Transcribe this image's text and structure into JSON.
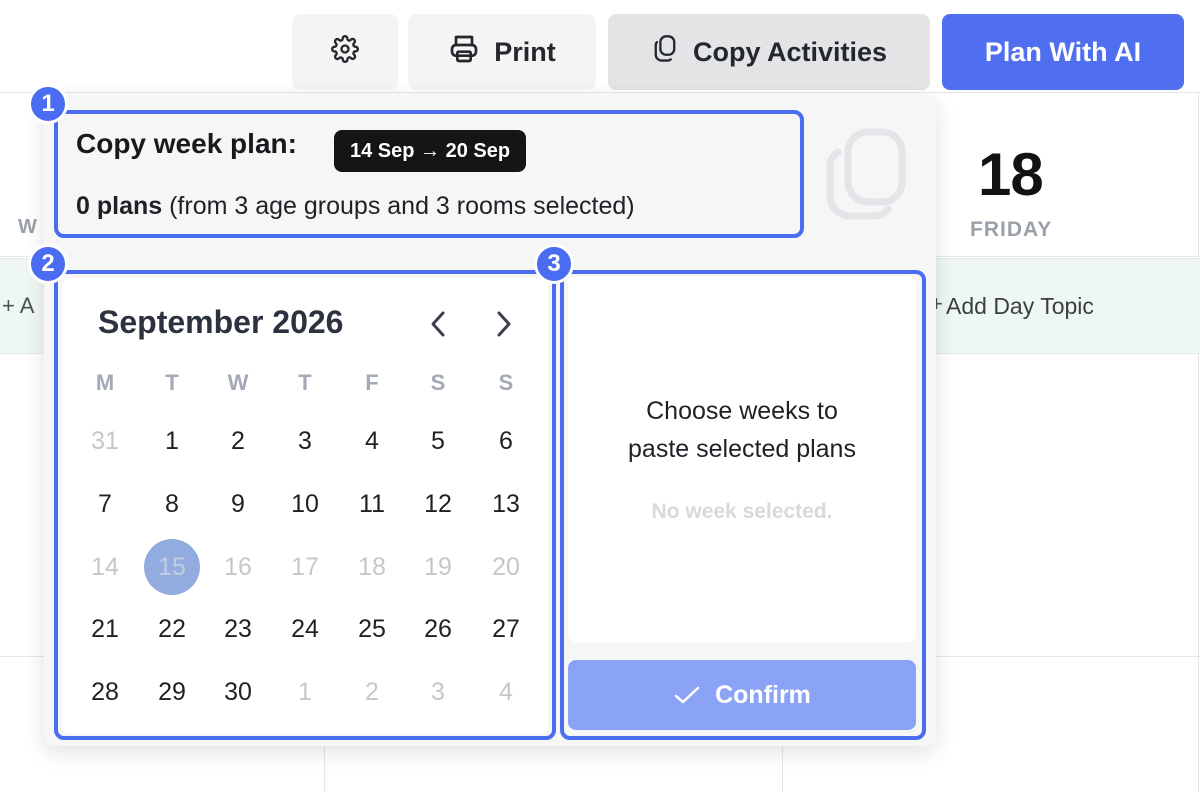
{
  "toolbar": {
    "settings_icon": "gear-icon",
    "print_label": "Print",
    "print_icon": "printer-icon",
    "copy_label": "Copy Activities",
    "copy_icon": "copy-icon",
    "ai_label": "Plan With AI"
  },
  "background": {
    "weekday_partial": "W",
    "add_topic_partial": "+ A",
    "add_topic_label": "Add Day Topic",
    "day_number": "18",
    "day_name": "FRIDAY"
  },
  "copy_panel": {
    "title": "Copy week plan:",
    "date_range": "14 Sep → 20 Sep",
    "plans_count": "0 plans",
    "plans_detail": "(from 3 age groups and 3 rooms selected)"
  },
  "calendar": {
    "month_label": "September 2026",
    "weekdays": [
      "M",
      "T",
      "W",
      "T",
      "F",
      "S",
      "S"
    ],
    "weeks": [
      [
        "31",
        "1",
        "2",
        "3",
        "4",
        "5",
        "6"
      ],
      [
        "7",
        "8",
        "9",
        "10",
        "11",
        "12",
        "13"
      ],
      [
        "14",
        "15",
        "16",
        "17",
        "18",
        "19",
        "20"
      ],
      [
        "21",
        "22",
        "23",
        "24",
        "25",
        "26",
        "27"
      ],
      [
        "28",
        "29",
        "30",
        "1",
        "2",
        "3",
        "4"
      ]
    ],
    "selected_day": "15"
  },
  "paste_panel": {
    "message_line1": "Choose weeks to",
    "message_line2": "paste selected plans",
    "empty_text": "No week selected.",
    "confirm_label": "Confirm"
  },
  "badges": [
    "1",
    "2",
    "3"
  ],
  "colors": {
    "accent": "#4f6ff0",
    "highlight": "#4a6cf0",
    "confirm_disabled": "#8ba3f6",
    "selected_day": "#93acdf",
    "chip_bg": "#141517"
  }
}
